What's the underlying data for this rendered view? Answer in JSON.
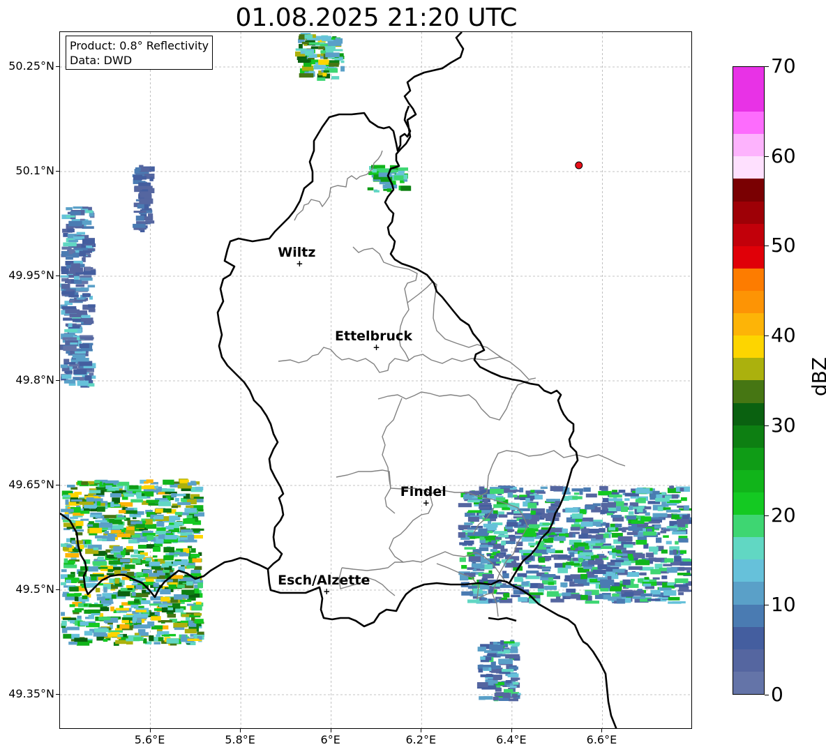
{
  "title": "01.08.2025 21:20 UTC",
  "info": {
    "product": "Product: 0.8° Reflectivity",
    "source": "Data: DWD"
  },
  "axes": {
    "lon_range": [
      5.4,
      6.8
    ],
    "lat_range": [
      49.3,
      50.3
    ],
    "x_ticks": [
      {
        "value": 5.6,
        "label": "5.6°E"
      },
      {
        "value": 5.8,
        "label": "5.8°E"
      },
      {
        "value": 6.0,
        "label": "6°E"
      },
      {
        "value": 6.2,
        "label": "6.2°E"
      },
      {
        "value": 6.4,
        "label": "6.4°E"
      },
      {
        "value": 6.6,
        "label": "6.6°E"
      }
    ],
    "y_ticks": [
      {
        "value": 50.25,
        "label": "50.25°N"
      },
      {
        "value": 50.1,
        "label": "50.1°N"
      },
      {
        "value": 49.95,
        "label": "49.95°N"
      },
      {
        "value": 49.8,
        "label": "49.8°N"
      },
      {
        "value": 49.65,
        "label": "49.65°N"
      },
      {
        "value": 49.5,
        "label": "49.5°N"
      },
      {
        "value": 49.35,
        "label": "49.35°N"
      }
    ],
    "grid": true
  },
  "cities": [
    {
      "name": "Wiltz",
      "lon": 5.93,
      "lat": 49.968
    },
    {
      "name": "Ettelbruck",
      "lon": 6.1,
      "lat": 49.848
    },
    {
      "name": "Findel",
      "lon": 6.21,
      "lat": 49.625
    },
    {
      "name": "Esch/Alzette",
      "lon": 5.99,
      "lat": 49.498
    }
  ],
  "radar_marker": {
    "lon": 6.548,
    "lat": 50.109,
    "color": "#e8101a"
  },
  "colorbar": {
    "title": "dBZ",
    "min": 0,
    "max": 70,
    "step": 2.5,
    "tick_labels": [
      "0",
      "10",
      "20",
      "30",
      "40",
      "50",
      "60",
      "70"
    ],
    "colors": [
      "#6474a8",
      "#5566a0",
      "#445e9f",
      "#4a7bb2",
      "#5aa0c8",
      "#66c1da",
      "#61d7c3",
      "#3ed672",
      "#14c922",
      "#11b41a",
      "#0f9c16",
      "#0d7f12",
      "#0a6110",
      "#467613",
      "#abb10d",
      "#fdd500",
      "#fdb407",
      "#fd9405",
      "#fd7c00",
      "#e00008",
      "#c2000a",
      "#9e0006",
      "#7a0002",
      "#fee0fe",
      "#fdb3fd",
      "#fd6cfd",
      "#e832e6",
      "#e832e6"
    ]
  },
  "echo_clusters": [
    {
      "name": "west-band",
      "lon": [
        5.4,
        5.48
      ],
      "lat": [
        49.79,
        50.05
      ],
      "dbz": [
        2,
        16
      ]
    },
    {
      "name": "north-west-cell",
      "lon": [
        5.56,
        5.61
      ],
      "lat": [
        50.01,
        50.11
      ],
      "dbz": [
        3,
        10
      ]
    },
    {
      "name": "south-west-storm",
      "lon": [
        5.4,
        5.72
      ],
      "lat": [
        49.42,
        49.66
      ],
      "dbz": [
        10,
        42
      ]
    },
    {
      "name": "north-cells",
      "lon": [
        6.08,
        6.18
      ],
      "lat": [
        50.07,
        50.11
      ],
      "dbz": [
        10,
        28
      ]
    },
    {
      "name": "top-edge-cell",
      "lon": [
        5.92,
        6.03
      ],
      "lat": [
        50.23,
        50.3
      ],
      "dbz": [
        10,
        40
      ]
    },
    {
      "name": "east-cells",
      "lon": [
        6.28,
        6.8
      ],
      "lat": [
        49.48,
        49.65
      ],
      "dbz": [
        3,
        25
      ]
    },
    {
      "name": "south-east-cell",
      "lon": [
        6.32,
        6.42
      ],
      "lat": [
        49.34,
        49.43
      ],
      "dbz": [
        3,
        22
      ]
    }
  ]
}
